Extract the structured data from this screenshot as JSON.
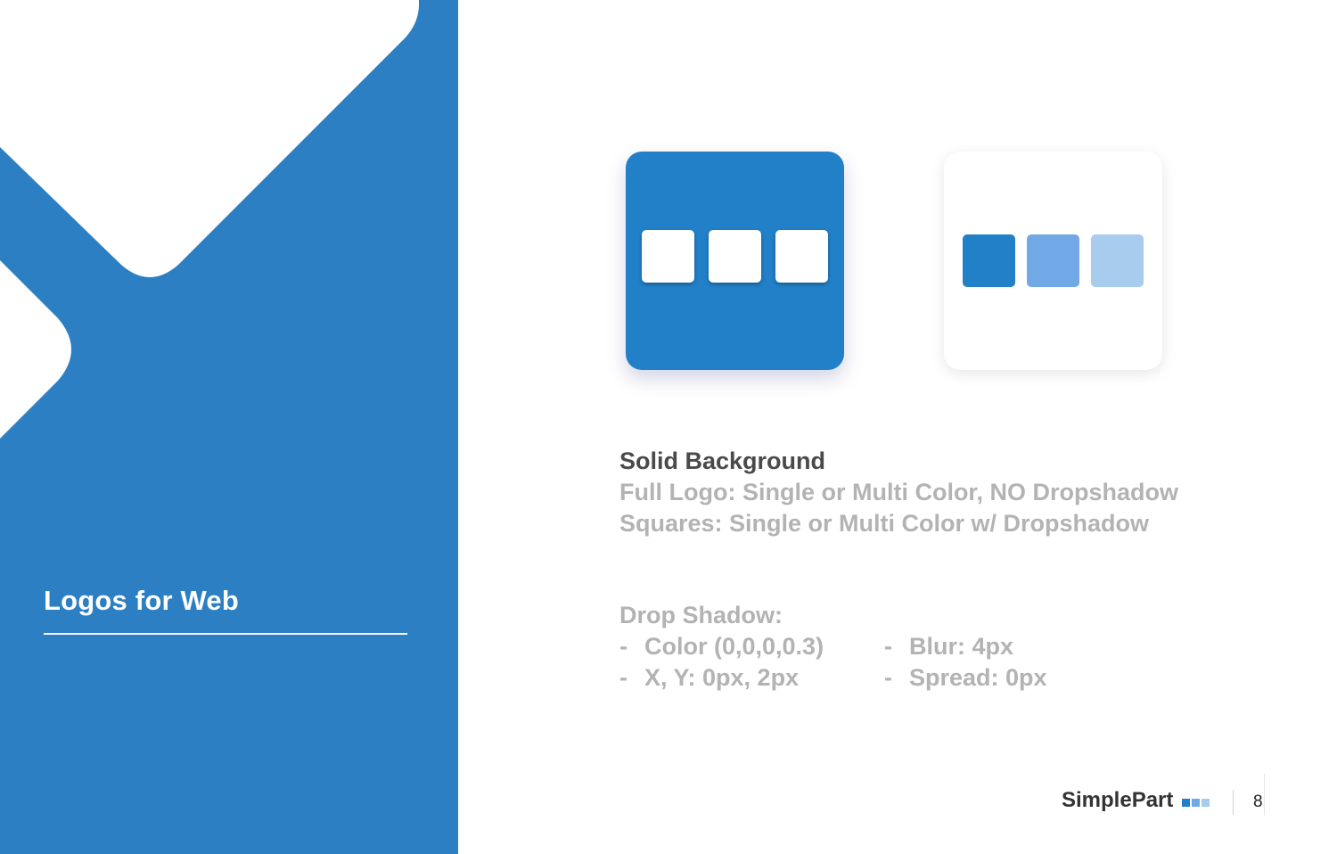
{
  "slide": {
    "section_title": "Logos for Web",
    "page_number": "8"
  },
  "colors": {
    "panel_blue": "#2b7fc2",
    "logo_blue": "#2180c8",
    "square_primary": "#2180c8",
    "square_mid": "#70a9e6",
    "square_light": "#a7ccee",
    "heading_text": "#4a4a4a",
    "body_text": "#b3b3b3"
  },
  "logos": {
    "solid_tile": {
      "label_icon": "solid-background-logo-icon",
      "square_color": "#ffffff"
    },
    "white_tile": {
      "label_icon": "multicolor-logo-icon",
      "square_colors": [
        "#2180c8",
        "#70a9e6",
        "#a7ccee"
      ]
    }
  },
  "description": {
    "heading": "Solid Background",
    "line1": "Full Logo: Single or Multi Color, NO Dropshadow",
    "line2": "Squares: Single or Multi Color w/ Dropshadow"
  },
  "drop_shadow": {
    "heading": "Drop Shadow:",
    "dash": "-",
    "color": "Color (0,0,0,0.3)",
    "xy": "X, Y: 0px, 2px",
    "blur": "Blur: 4px",
    "spread": "Spread: 0px"
  },
  "footer": {
    "brand": "SimplePart",
    "brand_icon": "simplepart-squares-icon"
  }
}
